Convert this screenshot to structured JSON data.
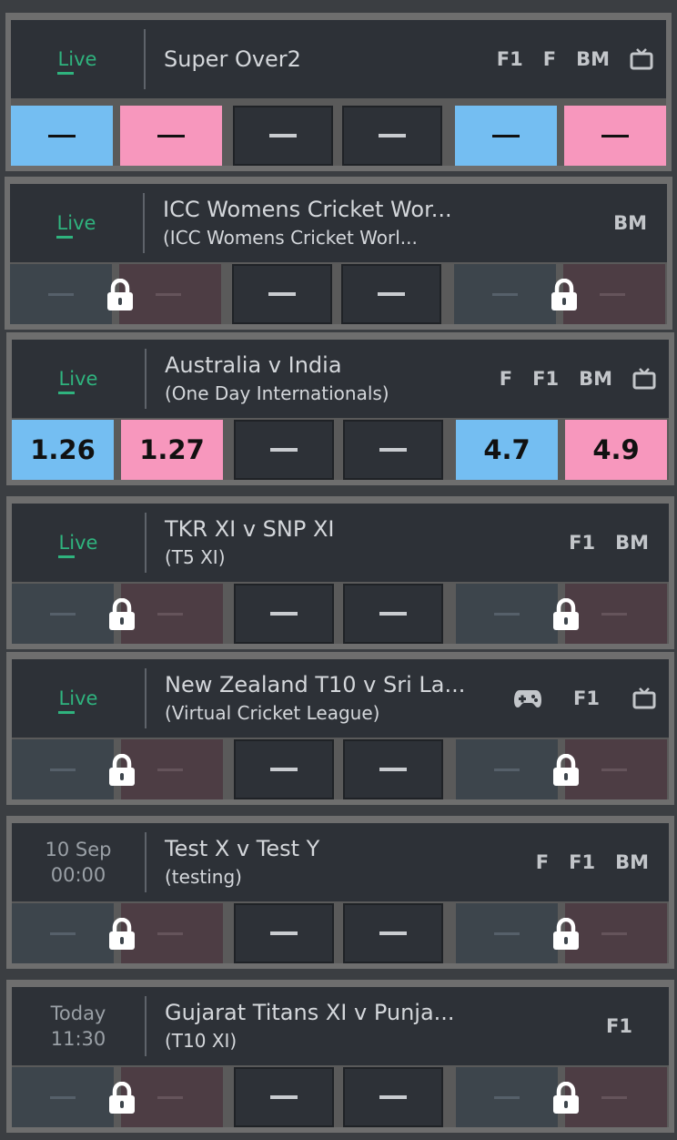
{
  "events": [
    {
      "status": "Live",
      "date": "",
      "time": "",
      "title": "Super Over2",
      "subtitle": "",
      "badges": [
        "F1",
        "F",
        "BM"
      ],
      "tv": true,
      "game": false,
      "suspended": false,
      "odds": [
        "—",
        "—",
        "—",
        "—",
        "—",
        "—"
      ]
    },
    {
      "status": "Live",
      "date": "",
      "time": "",
      "title": "ICC Womens Cricket Wor...",
      "subtitle": "(ICC Womens Cricket Worl...",
      "badges": [
        "BM"
      ],
      "tv": false,
      "game": false,
      "suspended": true,
      "odds": [
        "",
        "",
        "—",
        "—",
        "",
        ""
      ]
    },
    {
      "status": "Live",
      "date": "",
      "time": "",
      "title": "Australia v India",
      "subtitle": "(One Day Internationals)",
      "badges": [
        "F",
        "F1",
        "BM"
      ],
      "tv": true,
      "game": false,
      "suspended": false,
      "odds": [
        "1.26",
        "1.27",
        "—",
        "—",
        "4.7",
        "4.9"
      ]
    },
    {
      "status": "Live",
      "date": "",
      "time": "",
      "title": "TKR XI v SNP XI",
      "subtitle": "(T5 XI)",
      "badges": [
        "F1",
        "BM"
      ],
      "tv": false,
      "game": false,
      "suspended": true,
      "odds": [
        "",
        "",
        "—",
        "—",
        "",
        ""
      ]
    },
    {
      "status": "Live",
      "date": "",
      "time": "",
      "title": "New Zealand T10 v Sri La...",
      "subtitle": "(Virtual Cricket League)",
      "badges": [
        "F1"
      ],
      "tv": true,
      "game": true,
      "suspended": true,
      "odds": [
        "",
        "",
        "—",
        "—",
        "",
        ""
      ]
    },
    {
      "status": "",
      "date": "10 Sep",
      "time": "00:00",
      "title": "Test X v Test Y",
      "subtitle": "(testing)",
      "badges": [
        "F",
        "F1",
        "BM"
      ],
      "tv": false,
      "game": false,
      "suspended": true,
      "odds": [
        "",
        "",
        "—",
        "—",
        "",
        ""
      ]
    },
    {
      "status": "",
      "date": "Today",
      "time": "11:30",
      "title": "Gujarat Titans XI v Punja...",
      "subtitle": "(T10 XI)",
      "badges": [
        "F1"
      ],
      "tv": false,
      "game": false,
      "suspended": true,
      "odds": [
        "",
        "",
        "—",
        "—",
        "",
        ""
      ]
    }
  ],
  "colors": {
    "back": "#74bef2",
    "lay": "#f797bd",
    "live": "#2fb37e",
    "card": "#2d3137"
  }
}
